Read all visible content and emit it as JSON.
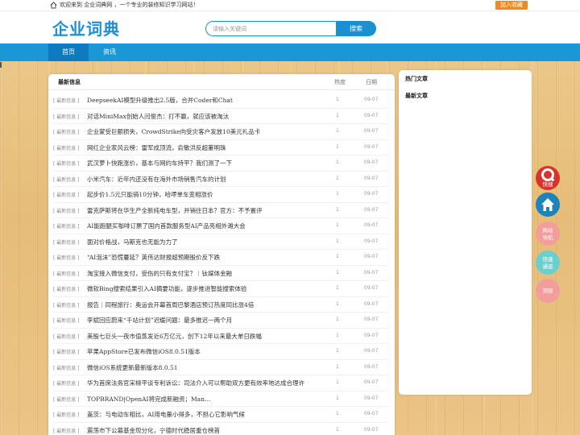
{
  "topbar": {
    "welcome": "欢迎来到 企业词典网 ，一个专业的装修知识学习网站！",
    "favorite_label": "加入收藏"
  },
  "header": {
    "logo": "企业词典",
    "search_placeholder": "请输入关键词",
    "search_button": "搜索"
  },
  "nav": {
    "items": [
      "首页",
      "资讯"
    ],
    "active": "首页"
  },
  "main": {
    "title": "最新信息",
    "col_heat": "热度",
    "col_date": "日期",
    "rows": [
      {
        "tag": "[ 最新信息 ]",
        "title": "DeepseekAI模型升级推出2.5版，合并Coder和Chat",
        "heat": "1",
        "date": "09-07"
      },
      {
        "tag": "[ 最新信息 ]",
        "title": "对话MiniMax创始人闫俊杰：打不赢，就应该被淘汰",
        "heat": "1",
        "date": "09-07"
      },
      {
        "tag": "[ 最新信息 ]",
        "title": "企业蒙受巨额损失，CrowdStrike向受灾客户发放10美元礼品卡",
        "heat": "1",
        "date": "09-07"
      },
      {
        "tag": "[ 最新信息 ]",
        "title": "网红企业家风云榜：雷军成顶流，俞敏洪反超董明珠",
        "heat": "1",
        "date": "09-07"
      },
      {
        "tag": "[ 最新信息 ]",
        "title": "武汉萝卜快跑涨价，基本与网约车持平？我们测了一下",
        "heat": "1",
        "date": "09-07"
      },
      {
        "tag": "[ 最新信息 ]",
        "title": "小米汽车：近年内还没有在海外市场销售汽车的计划",
        "heat": "1",
        "date": "09-07"
      },
      {
        "tag": "[ 最新信息 ]",
        "title": "起步价1.5元只能骑10分钟，哈啰单车变相涨价",
        "heat": "1",
        "date": "09-07"
      },
      {
        "tag": "[ 最新信息 ]",
        "title": "雷克萨斯将在华生产全新纯电车型，并销往日本？官方：不予置评",
        "heat": "1",
        "date": "09-07"
      },
      {
        "tag": "[ 最新信息 ]",
        "title": "AI能跑腿买咖啡订票了国内首款服务型AI产品亮相外滩大会",
        "heat": "1",
        "date": "09-07"
      },
      {
        "tag": "[ 最新信息 ]",
        "title": "面对价格战，马斯克也无能为力了",
        "heat": "1",
        "date": "09-07"
      },
      {
        "tag": "[ 最新信息 ]",
        "title": "“AI泡沫”恐慌蔓延？英伟达财报超预期股价反下跌",
        "heat": "1",
        "date": "09-07"
      },
      {
        "tag": "[ 最新信息 ]",
        "title": "淘宝接入微信支付，受伤的只有支付宝？｜钛媒体金融",
        "heat": "1",
        "date": "09-07"
      },
      {
        "tag": "[ 最新信息 ]",
        "title": "微软Bing搜索结果引入AI摘要功能，逐步推进智能搜索体验",
        "heat": "1",
        "date": "09-07"
      },
      {
        "tag": "[ 最新信息 ]",
        "title": "报告｜同程旅行：奥运会开幕首周巴黎酒店预订热度同比涨4倍",
        "heat": "1",
        "date": "09-07"
      },
      {
        "tag": "[ 最新信息 ]",
        "title": "李斌回应蔚来“千站计划”迟缓问题：最多推迟一两个月",
        "heat": "1",
        "date": "09-07"
      },
      {
        "tag": "[ 最新信息 ]",
        "title": "美股七巨头一夜市值蒸发近6万亿元，创下12年以来最大单日跌幅",
        "heat": "1",
        "date": "09-07"
      },
      {
        "tag": "[ 最新信息 ]",
        "title": "苹果AppStore已发布微信iOS8.0.51版本",
        "heat": "1",
        "date": "09-07"
      },
      {
        "tag": "[ 最新信息 ]",
        "title": "微信iOS系统更新最新版本8.0.51",
        "heat": "1",
        "date": "09-07"
      },
      {
        "tag": "[ 最新信息 ]",
        "title": "华为首席法务官宋柳平谈专利诉讼：司法介入可以帮助双方更有效率地达成合理许",
        "heat": "1",
        "date": "09-07"
      },
      {
        "tag": "[ 最新信息 ]",
        "title": "TOPBRAND|OpenAI将完成新融资；Man...",
        "heat": "1",
        "date": "09-07"
      },
      {
        "tag": "[ 最新信息 ]",
        "title": "盖茨：与电动车相比，AI用电量小得多，不担心它影响气候",
        "heat": "1",
        "date": "09-07"
      },
      {
        "tag": "[ 最新信息 ]",
        "title": "震荡市下公募基金现分化，宁德时代稳居重仓榜首",
        "heat": "1",
        "date": "09-07"
      }
    ]
  },
  "side": {
    "hot_title": "热门文章",
    "latest_title": "最新文章"
  },
  "float": {
    "quick": "快搜",
    "nav_line1": "网站",
    "nav_line2": "导航",
    "fast_line1": "快速",
    "fast_line2": "通道",
    "top": "顶部"
  },
  "colors": {
    "brand_blue": "#1c97d6",
    "accent_orange": "#f08a1d"
  }
}
